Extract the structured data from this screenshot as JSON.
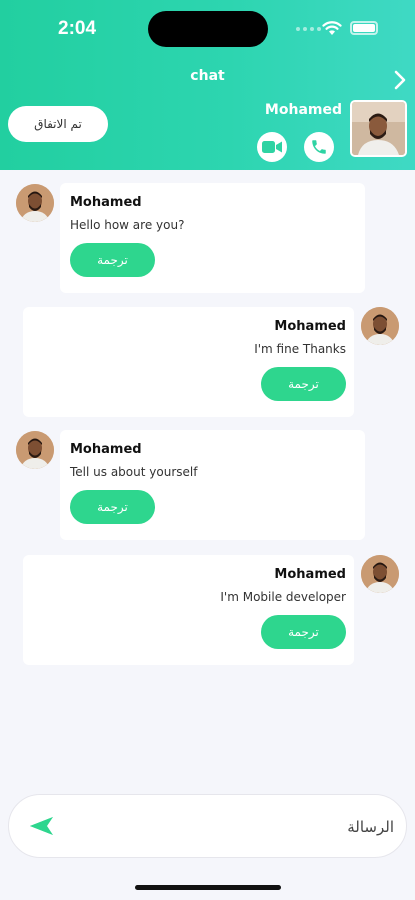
{
  "status_bar": {
    "time": "2:04"
  },
  "header": {
    "title": "chat",
    "agree_label": "تم الاتفاق",
    "contact_name": "Mohamed",
    "icons": {
      "back": "chevron-right-icon",
      "video": "video-camera-icon",
      "phone": "phone-icon"
    }
  },
  "messages": [
    {
      "side": "left",
      "name": "Mohamed",
      "text": "Hello how are you?",
      "button": "ترجمة"
    },
    {
      "side": "right",
      "name": "Mohamed",
      "text": "I'm fine Thanks",
      "button": "ترجمة"
    },
    {
      "side": "left",
      "name": "Mohamed",
      "text": "Tell us about yourself",
      "button": "ترجمة"
    },
    {
      "side": "right",
      "name": "Mohamed",
      "text": "I'm Mobile developer",
      "button": "ترجمة"
    }
  ],
  "composer": {
    "placeholder": "الرسالة",
    "send_icon": "send-icon"
  },
  "colors": {
    "header_start": "#22cfa0",
    "header_end": "#3fd9c4",
    "accent": "#2ed68e",
    "background": "#f5f6fb"
  }
}
